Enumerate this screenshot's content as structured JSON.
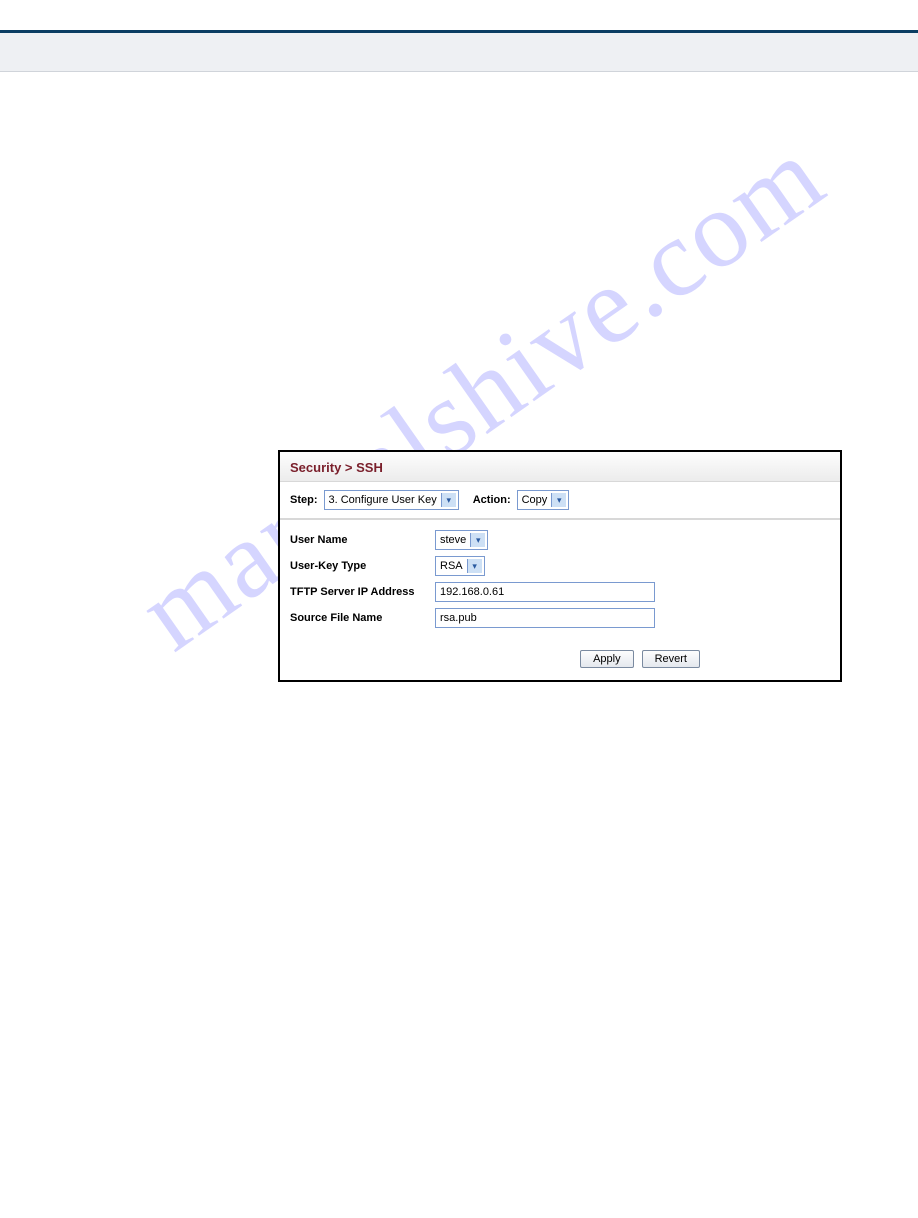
{
  "watermark": "manualshive.com",
  "panel": {
    "breadcrumb_a": "Security",
    "sep": " > ",
    "breadcrumb_b": "SSH",
    "toolbar": {
      "step_label": "Step:",
      "step_value": "3. Configure User Key",
      "action_label": "Action:",
      "action_value": "Copy"
    },
    "fields": {
      "user_name_label": "User Name",
      "user_name_value": "steve",
      "user_key_type_label": "User-Key Type",
      "user_key_type_value": "RSA",
      "tftp_label": "TFTP Server IP Address",
      "tftp_value": "192.168.0.61",
      "source_file_label": "Source File Name",
      "source_file_value": "rsa.pub"
    },
    "buttons": {
      "apply": "Apply",
      "revert": "Revert"
    }
  }
}
